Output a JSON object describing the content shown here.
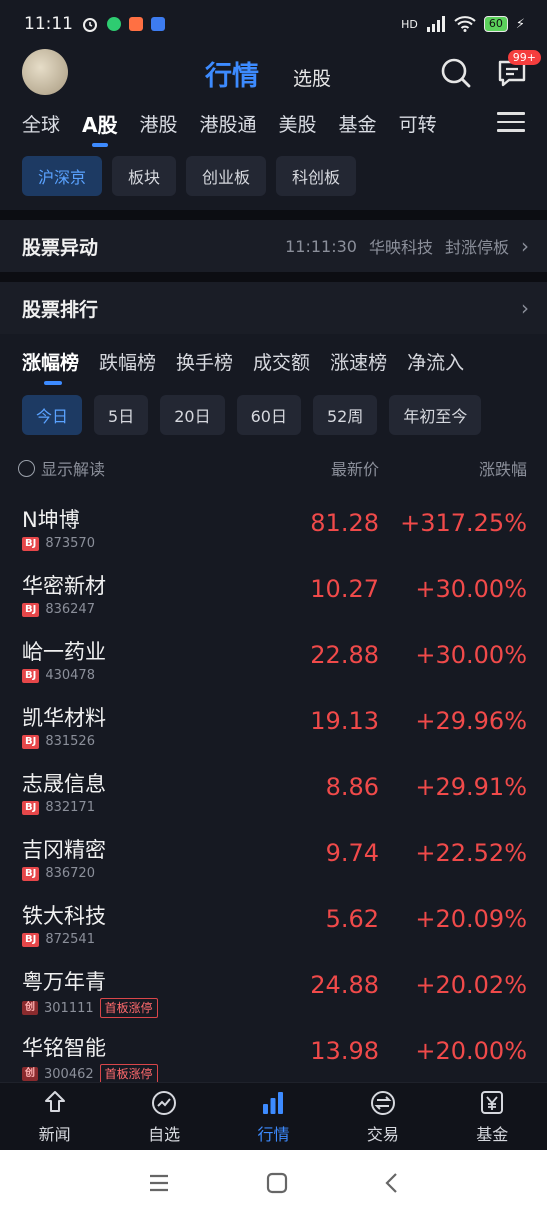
{
  "status": {
    "time": "11:11",
    "battery": "60",
    "network": "HD"
  },
  "header": {
    "active_tab": "行情",
    "other_tab": "选股",
    "badge": "99+"
  },
  "market_tabs": [
    "全球",
    "A股",
    "港股",
    "港股通",
    "美股",
    "基金",
    "可转"
  ],
  "sub_tabs": [
    "沪深京",
    "板块",
    "创业板",
    "科创板"
  ],
  "anomaly": {
    "title": "股票异动",
    "time": "11:11:30",
    "stock": "华映科技",
    "event": "封涨停板"
  },
  "ranking": {
    "title": "股票排行"
  },
  "rank_tabs": [
    "涨幅榜",
    "跌幅榜",
    "换手榜",
    "成交额",
    "涨速榜",
    "净流入"
  ],
  "period_tabs": [
    "今日",
    "5日",
    "20日",
    "60日",
    "52周",
    "年初至今"
  ],
  "list_header": {
    "toggle": "显示解读",
    "price": "最新价",
    "change": "涨跌幅"
  },
  "stocks": [
    {
      "name": "N坤博",
      "exchange": "BJ",
      "code": "873570",
      "price": "81.28",
      "change": "+317.25%",
      "tag": ""
    },
    {
      "name": "华密新材",
      "exchange": "BJ",
      "code": "836247",
      "price": "10.27",
      "change": "+30.00%",
      "tag": ""
    },
    {
      "name": "峆一药业",
      "exchange": "BJ",
      "code": "430478",
      "price": "22.88",
      "change": "+30.00%",
      "tag": ""
    },
    {
      "name": "凯华材料",
      "exchange": "BJ",
      "code": "831526",
      "price": "19.13",
      "change": "+29.96%",
      "tag": ""
    },
    {
      "name": "志晟信息",
      "exchange": "BJ",
      "code": "832171",
      "price": "8.86",
      "change": "+29.91%",
      "tag": ""
    },
    {
      "name": "吉冈精密",
      "exchange": "BJ",
      "code": "836720",
      "price": "9.74",
      "change": "+22.52%",
      "tag": ""
    },
    {
      "name": "铁大科技",
      "exchange": "BJ",
      "code": "872541",
      "price": "5.62",
      "change": "+20.09%",
      "tag": ""
    },
    {
      "name": "粤万年青",
      "exchange": "创",
      "code": "301111",
      "price": "24.88",
      "change": "+20.02%",
      "tag": "首板涨停"
    },
    {
      "name": "华铭智能",
      "exchange": "创",
      "code": "300462",
      "price": "13.98",
      "change": "+20.00%",
      "tag": "首板涨停"
    }
  ],
  "bottom_nav": [
    "新闻",
    "自选",
    "行情",
    "交易",
    "基金"
  ],
  "colors": {
    "accent": "#3d8bff",
    "up": "#f04a4a",
    "background": "#161922"
  }
}
